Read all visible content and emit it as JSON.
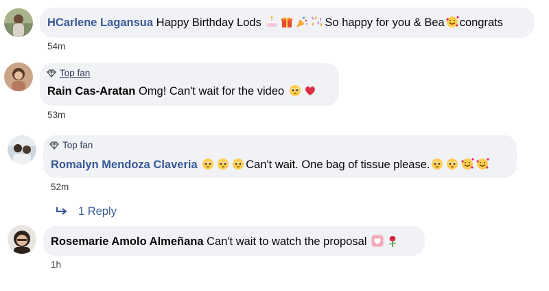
{
  "comments": [
    {
      "author": "HCarlene Lagansua",
      "text_before": "Happy Birthday Lods ",
      "text_after": "So happy for you & Bea",
      "text_end": "congrats",
      "time": "54m"
    },
    {
      "badge": "Top fan",
      "author": "Rain Cas-Aratan",
      "text": "Omg! Can't wait for the video ",
      "time": "53m"
    },
    {
      "badge": "Top fan",
      "author": "Romalyn Mendoza Claveria",
      "text": "Can't wait. One bag of tissue please.",
      "time": "52m",
      "replies_label": "1 Reply"
    },
    {
      "author": "Rosemarie Amolo Almeñana",
      "text": "Can't wait to watch the proposal ",
      "time": "1h"
    }
  ],
  "colors": {
    "bubble": "#f0f2f5",
    "link_name": "#385898",
    "reply_link": "#3a5a98"
  },
  "icons": [
    "gem-icon",
    "reply-arrow-icon",
    "cake-emoji",
    "gift-emoji",
    "party-popper-emoji",
    "confetti-emoji",
    "smiling-hearts-emoji",
    "pleading-face-emoji",
    "red-heart-emoji",
    "heart-box-emoji",
    "rose-emoji"
  ]
}
